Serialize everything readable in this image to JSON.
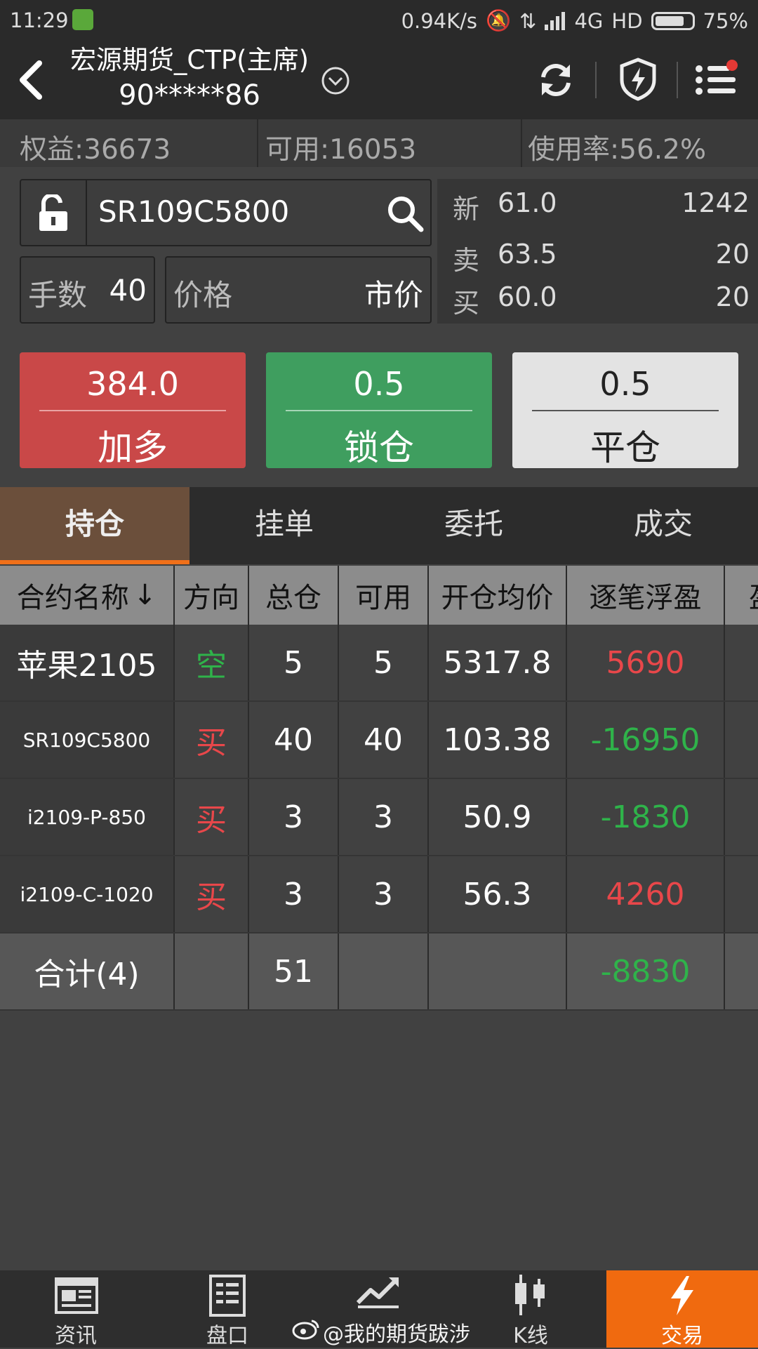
{
  "status": {
    "time": "11:29",
    "net_speed": "0.94K/s",
    "network": "4G",
    "hd": "HD",
    "battery": "75%"
  },
  "header": {
    "broker": "宏源期货_CTP(主席)",
    "account": "90*****86"
  },
  "summary": {
    "equity": "权益:36673",
    "available": "可用:16053",
    "usage": "使用率:56.2%"
  },
  "order": {
    "contract": "SR109C5800",
    "lots_label": "手数",
    "lots_value": "40",
    "price_label": "价格",
    "price_value": "市价"
  },
  "quote": {
    "last": {
      "label": "新",
      "price": "61.0",
      "qty": "1242"
    },
    "ask": {
      "label": "卖",
      "price": "63.5",
      "qty": "20"
    },
    "bid": {
      "label": "买",
      "price": "60.0",
      "qty": "20"
    }
  },
  "buttons": {
    "buy": {
      "value": "384.0",
      "label": "加多"
    },
    "lock": {
      "value": "0.5",
      "label": "锁仓"
    },
    "close": {
      "value": "0.5",
      "label": "平仓"
    }
  },
  "tabs": [
    "持仓",
    "挂单",
    "委托",
    "成交"
  ],
  "table": {
    "headers": [
      "合约名称",
      "方向",
      "总仓",
      "可用",
      "开仓均价",
      "逐笔浮盈",
      "盈"
    ],
    "sort_arrow": "↓",
    "rows": [
      {
        "name": "苹果2105",
        "dir": "空",
        "total": "5",
        "avail": "5",
        "avg": "5317.8",
        "pnl": "5690"
      },
      {
        "name": "SR109C5800",
        "dir": "买",
        "total": "40",
        "avail": "40",
        "avg": "103.38",
        "pnl": "-16950"
      },
      {
        "name": "i2109-P-850",
        "dir": "买",
        "total": "3",
        "avail": "3",
        "avg": "50.9",
        "pnl": "-1830"
      },
      {
        "name": "i2109-C-1020",
        "dir": "买",
        "total": "3",
        "avail": "3",
        "avg": "56.3",
        "pnl": "4260"
      }
    ],
    "total": {
      "name": "合计(4)",
      "total": "51",
      "pnl": "-8830"
    }
  },
  "nav": [
    "资讯",
    "盘口",
    "",
    "K线",
    "交易"
  ],
  "watermark": "@我的期货跋涉",
  "colors": {
    "accent": "#f06a0f",
    "buy": "#c94848",
    "lock": "#3f9e5f",
    "up": "#e8474a",
    "down": "#2fb34a"
  }
}
